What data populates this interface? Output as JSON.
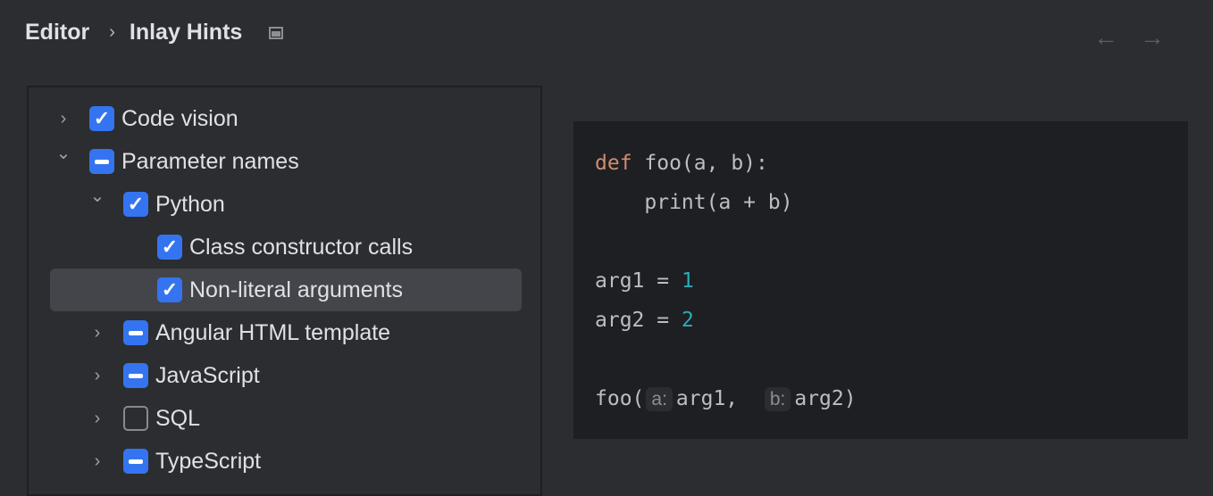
{
  "breadcrumb": {
    "parent": "Editor",
    "current": "Inlay Hints"
  },
  "nav": {
    "back": "←",
    "forward": "→"
  },
  "tree": [
    {
      "label": "Code vision",
      "level": 0,
      "expanded": false,
      "state": "checked"
    },
    {
      "label": "Parameter names",
      "level": 0,
      "expanded": true,
      "state": "mixed"
    },
    {
      "label": "Python",
      "level": 1,
      "expanded": true,
      "state": "checked"
    },
    {
      "label": "Class constructor calls",
      "level": 2,
      "state": "checked"
    },
    {
      "label": "Non-literal arguments",
      "level": 2,
      "state": "checked",
      "selected": true
    },
    {
      "label": "Angular HTML template",
      "level": 1,
      "expanded": false,
      "state": "mixed"
    },
    {
      "label": "JavaScript",
      "level": 1,
      "expanded": false,
      "state": "mixed"
    },
    {
      "label": "SQL",
      "level": 1,
      "expanded": false,
      "state": "unchecked"
    },
    {
      "label": "TypeScript",
      "level": 1,
      "expanded": false,
      "state": "mixed"
    }
  ],
  "code": {
    "kw_def": "def",
    "l1": " foo(a, b):",
    "l2": "    print(a + b)",
    "l3a": "arg1 = ",
    "n1": "1",
    "l4a": "arg2 = ",
    "n2": "2",
    "call": "foo(",
    "hint_a": "a:",
    "arg1": "arg1,  ",
    "hint_b": "b:",
    "arg2": "arg2)"
  }
}
